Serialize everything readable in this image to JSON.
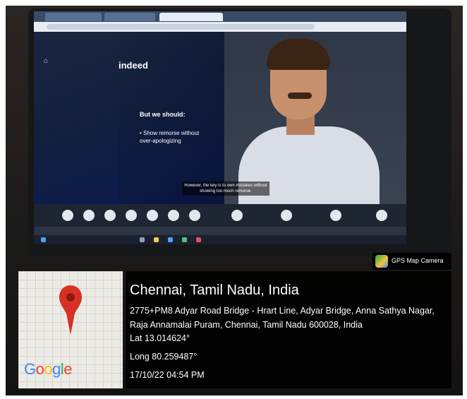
{
  "photo": {
    "screen": {
      "logo": "indeed",
      "home_glyph": "⌂",
      "slide_title": "But we should:",
      "slide_bullet": "• Show remorse without over-apologizing",
      "caption": "However, the key is to own mistakes without showing too much remorse."
    }
  },
  "overlay": {
    "badge_label": "GPS Map Camera",
    "place": "Chennai, Tamil Nadu, India",
    "address": "2775+PM8 Adyar Road Bridge - Hrart Line, Adyar Bridge, Anna Sathya Nagar, Raja Annamalai Puram, Chennai, Tamil Nadu 600028, India",
    "lat": "Lat 13.014624°",
    "long": "Long 80.259487°",
    "timestamp": "17/10/22 04:54 PM",
    "map_brand": "Google",
    "colors": {
      "panel": "#000000",
      "pin": "#d93025",
      "text": "#ffffff"
    }
  }
}
